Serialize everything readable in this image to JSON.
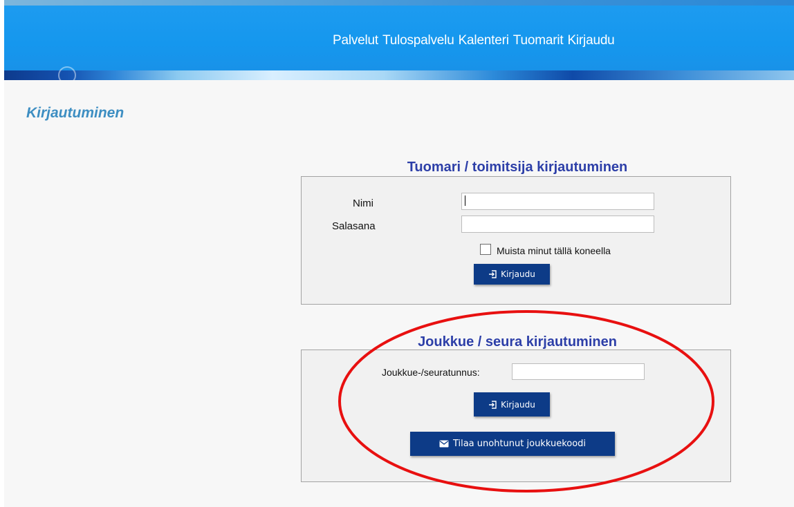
{
  "header": {
    "nav": [
      {
        "label": "Palvelut"
      },
      {
        "label": "Tulospalvelu"
      },
      {
        "label": "Kalenteri"
      },
      {
        "label": "Tuomarit"
      },
      {
        "label": "Kirjaudu"
      }
    ]
  },
  "page": {
    "title": "Kirjautuminen"
  },
  "referee_login": {
    "title": "Tuomari / toimitsija kirjautuminen",
    "name_label": "Nimi",
    "name_value": "",
    "password_label": "Salasana",
    "password_value": "",
    "remember_label": "Muista minut tällä koneella",
    "remember_checked": false,
    "submit_label": "Kirjaudu"
  },
  "team_login": {
    "title": "Joukkue / seura kirjautuminen",
    "code_label": "Joukkue-/seuratunnus:",
    "code_value": "",
    "submit_label": "Kirjaudu",
    "forgot_label": "Tilaa unohtunut joukkuekoodi"
  },
  "colors": {
    "header_blue": "#1597ee",
    "button_navy": "#0d3b87",
    "title_blue": "#3d8ec2",
    "section_title": "#2d3fa8",
    "annotation_red": "#e81010"
  },
  "icons": {
    "login": "login-arrow-icon",
    "mail": "envelope-icon"
  }
}
